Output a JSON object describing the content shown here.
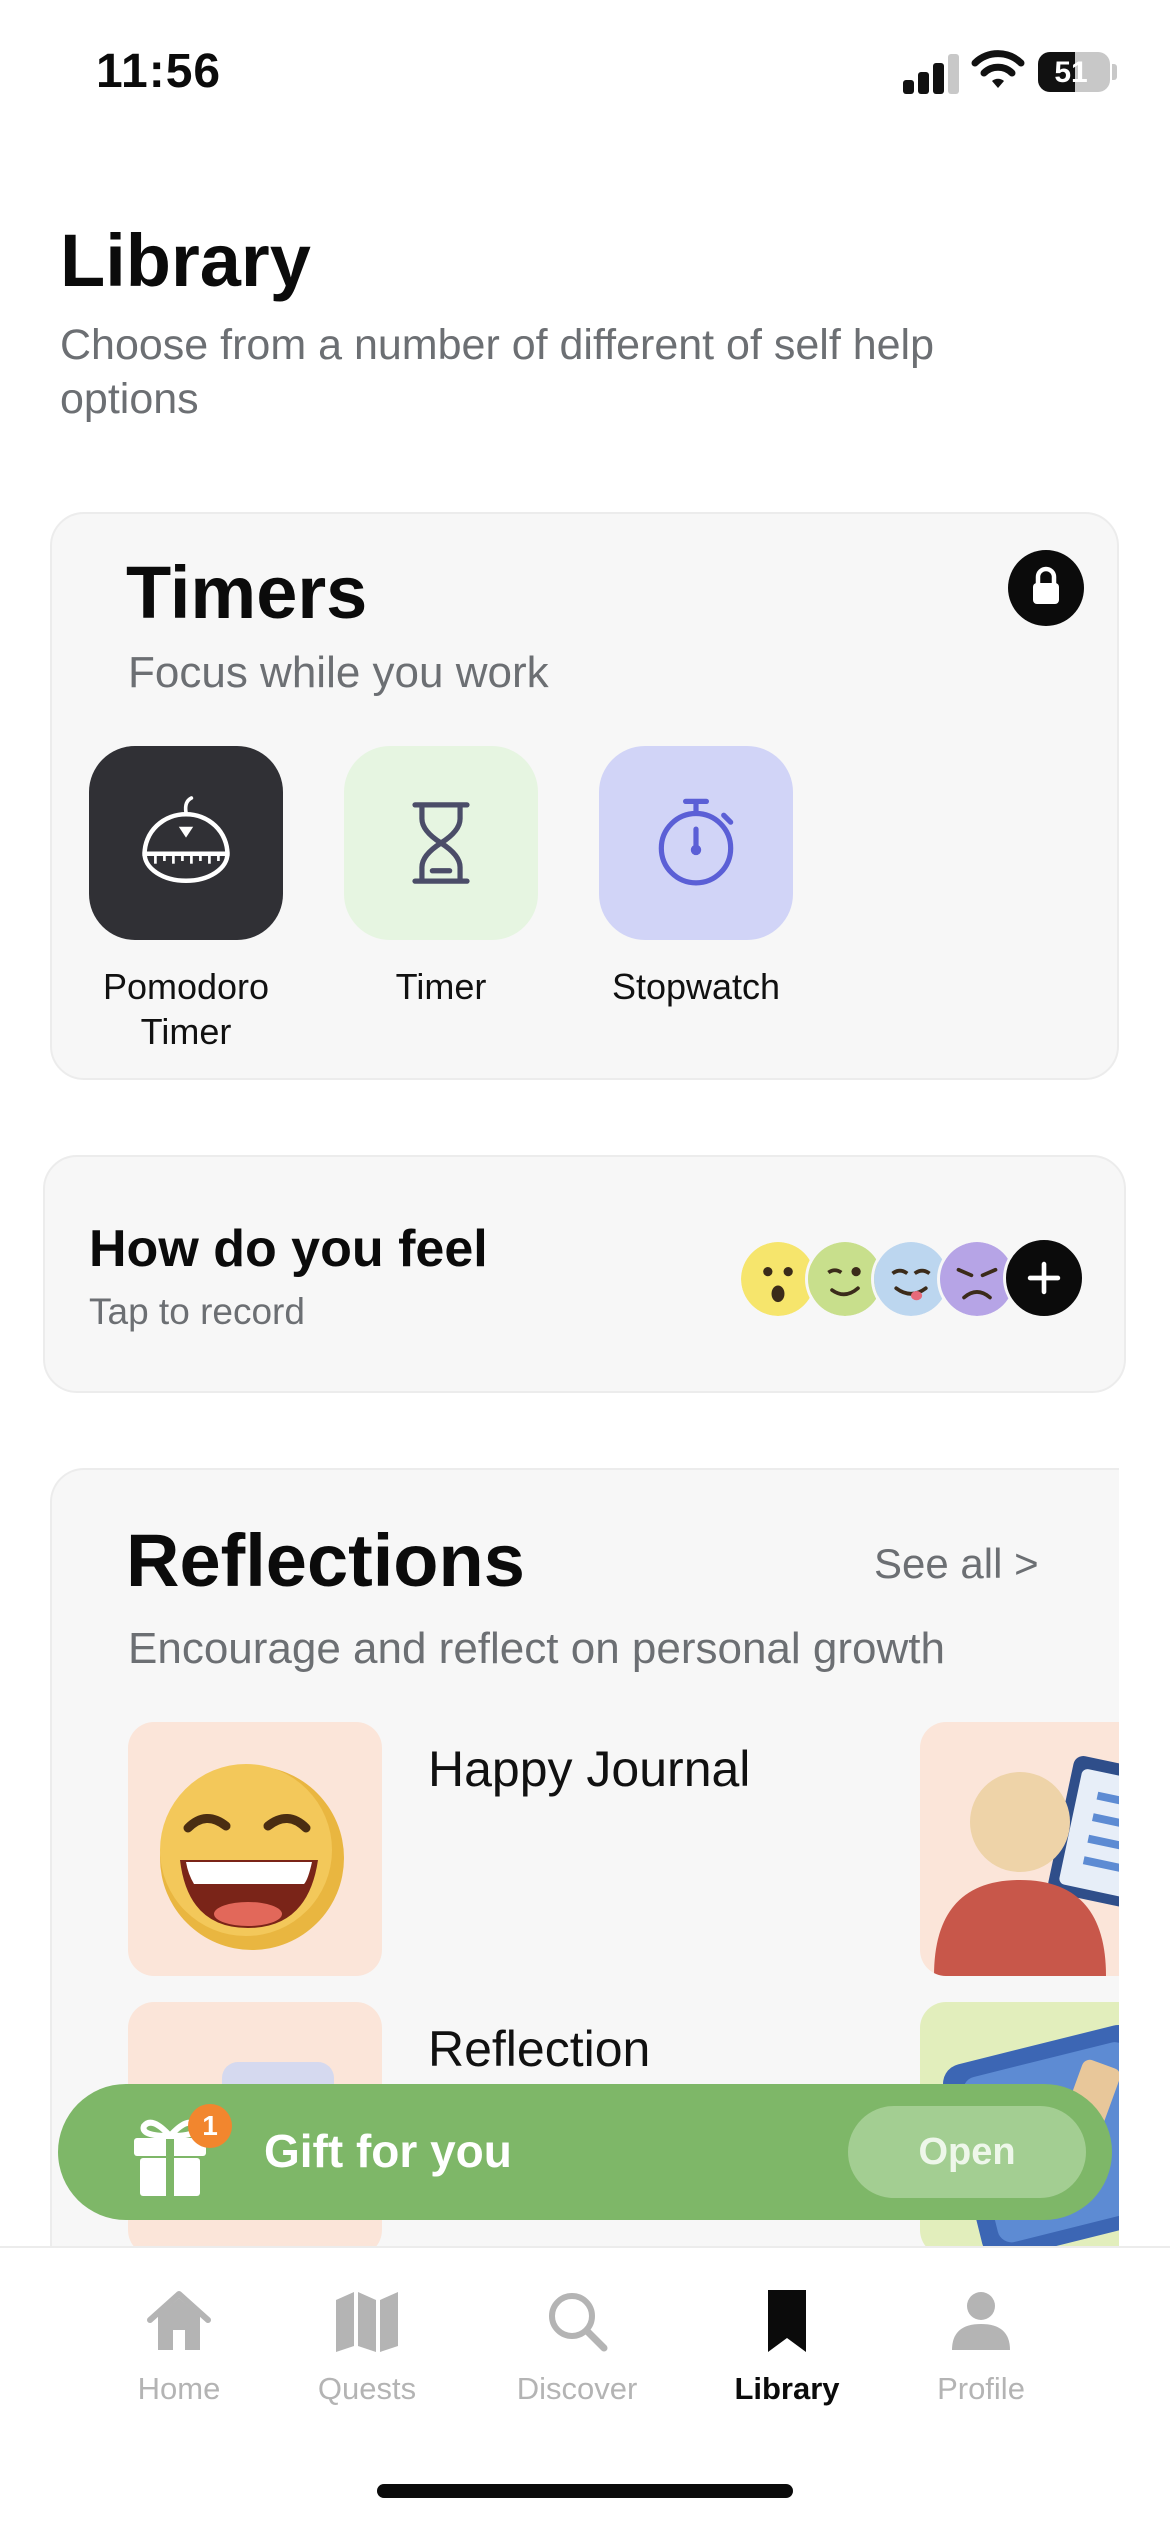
{
  "status_bar": {
    "time": "11:56",
    "battery": "51"
  },
  "header": {
    "title": "Library",
    "subtitle": "Choose from a number of different of self help options"
  },
  "timers": {
    "title": "Timers",
    "subtitle": "Focus while you work",
    "items": [
      {
        "label": "Pomodoro Timer",
        "icon": "pomodoro-icon",
        "bg": "#303035"
      },
      {
        "label": "Timer",
        "icon": "hourglass-icon",
        "bg": "#e6f5e1"
      },
      {
        "label": "Stopwatch",
        "icon": "stopwatch-icon",
        "bg": "#d1d4f7"
      }
    ]
  },
  "feel": {
    "title": "How do you feel",
    "subtitle": "Tap to record",
    "moods": [
      "surprised",
      "winking",
      "silly",
      "sad"
    ]
  },
  "reflections": {
    "title": "Reflections",
    "see_all": "See all >",
    "subtitle": "Encourage and reflect on personal growth",
    "items": [
      {
        "title": "Happy Journal",
        "thumb_bg": "#fbe5d9"
      },
      {
        "title": "Reflection",
        "thumb_bg": "#fbe5d9"
      }
    ]
  },
  "gift": {
    "label": "Gift for you",
    "badge": "1",
    "button": "Open"
  },
  "tabs": [
    {
      "label": "Home",
      "icon": "home-icon",
      "active": false
    },
    {
      "label": "Quests",
      "icon": "map-icon",
      "active": false
    },
    {
      "label": "Discover",
      "icon": "search-icon",
      "active": false
    },
    {
      "label": "Library",
      "icon": "bookmark-icon",
      "active": true
    },
    {
      "label": "Profile",
      "icon": "person-icon",
      "active": false
    }
  ],
  "colors": {
    "accent_green": "#7eb768",
    "muted_text": "#6c6f73",
    "inactive_tab": "#b4b4b4"
  }
}
